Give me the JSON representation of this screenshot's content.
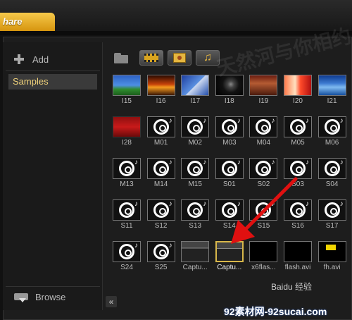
{
  "app_tab": {
    "label": "hare"
  },
  "toolbar": {
    "folder": "folder-icon",
    "video": "video-filter-icon",
    "photo": "photo-filter-icon",
    "music": "music-filter-icon"
  },
  "sidebar": {
    "add_label": "Add",
    "items": [
      {
        "label": "Samples",
        "selected": true
      }
    ],
    "browse_label": "Browse"
  },
  "collapse_button": {
    "label": "«"
  },
  "grid": {
    "tiles": [
      {
        "caption": "I15",
        "kind": "sky"
      },
      {
        "caption": "I16",
        "kind": "sunset"
      },
      {
        "caption": "I17",
        "kind": "blueimg"
      },
      {
        "caption": "I18",
        "kind": "dark"
      },
      {
        "caption": "I19",
        "kind": "room"
      },
      {
        "caption": "I20",
        "kind": "rose"
      },
      {
        "caption": "I21",
        "kind": "water"
      },
      {
        "caption": "I28",
        "kind": "red"
      },
      {
        "caption": "M01",
        "kind": "cd"
      },
      {
        "caption": "M02",
        "kind": "cd"
      },
      {
        "caption": "M03",
        "kind": "cd"
      },
      {
        "caption": "M04",
        "kind": "cd"
      },
      {
        "caption": "M05",
        "kind": "cd"
      },
      {
        "caption": "M06",
        "kind": "cd"
      },
      {
        "caption": "M13",
        "kind": "cd"
      },
      {
        "caption": "M14",
        "kind": "cd"
      },
      {
        "caption": "M15",
        "kind": "cd"
      },
      {
        "caption": "S01",
        "kind": "cd"
      },
      {
        "caption": "S02",
        "kind": "cd"
      },
      {
        "caption": "S03",
        "kind": "cd"
      },
      {
        "caption": "S04",
        "kind": "cd"
      },
      {
        "caption": "S11",
        "kind": "cd"
      },
      {
        "caption": "S12",
        "kind": "cd"
      },
      {
        "caption": "S13",
        "kind": "cd"
      },
      {
        "caption": "S14",
        "kind": "cd"
      },
      {
        "caption": "S15",
        "kind": "cd"
      },
      {
        "caption": "S16",
        "kind": "cd"
      },
      {
        "caption": "S17",
        "kind": "cd"
      },
      {
        "caption": "S24",
        "kind": "cd"
      },
      {
        "caption": "S25",
        "kind": "cd"
      },
      {
        "caption": "Captu...",
        "kind": "capture"
      },
      {
        "caption": "Captu...",
        "kind": "capture",
        "selected": true
      },
      {
        "caption": "x6flas...",
        "kind": "flash"
      },
      {
        "caption": "flash.avi",
        "kind": "flash"
      },
      {
        "caption": "fh.avi",
        "kind": "fh"
      }
    ]
  },
  "watermark": "天然河与你相约",
  "footer": {
    "logo": "Baidu 经验",
    "url": "92素材网-92sucai.com"
  },
  "colors": {
    "accent": "#d6950f",
    "selected_text": "#f0d27a",
    "arrow": "#e01010"
  }
}
